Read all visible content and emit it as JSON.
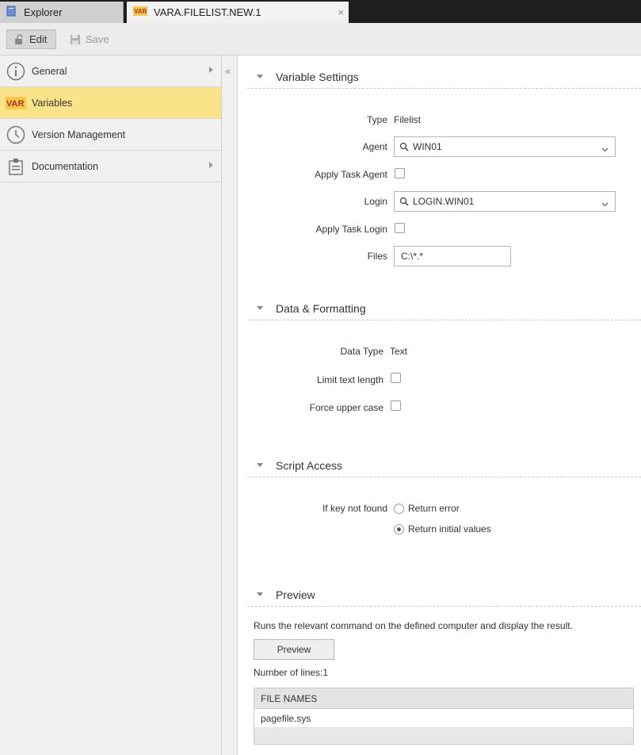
{
  "tabs": [
    {
      "label": "Explorer",
      "icon": "explorer-icon"
    },
    {
      "label": "VARA.FILELIST.NEW.1",
      "icon": "var-icon",
      "close": "×"
    }
  ],
  "toolbar": {
    "edit_label": "Edit",
    "save_label": "Save"
  },
  "sidebar": {
    "items": [
      {
        "label": "General",
        "icon": "info-icon"
      },
      {
        "label": "Variables",
        "icon": "var-icon",
        "icon_text": "VAR"
      },
      {
        "label": "Version Management",
        "icon": "clock-icon"
      },
      {
        "label": "Documentation",
        "icon": "clipboard-icon"
      }
    ],
    "selected_color": "#fbe38a"
  },
  "collapse": "«",
  "sections": {
    "variable_settings": {
      "title": "Variable Settings",
      "type_label": "Type",
      "type_value": "Filelist",
      "agent_label": "Agent",
      "agent_value": "WIN01",
      "apply_task_agent_label": "Apply Task Agent",
      "login_label": "Login",
      "login_value": "LOGIN.WIN01",
      "apply_task_login_label": "Apply Task Login",
      "files_label": "Files",
      "files_value": "C:\\*.*"
    },
    "data_formatting": {
      "title": "Data & Formatting",
      "data_type_label": "Data Type",
      "data_type_value": "Text",
      "limit_label": "Limit text length",
      "upper_label": "Force upper case"
    },
    "script_access": {
      "title": "Script Access",
      "key_label": "If key not found",
      "opt_error": "Return error",
      "opt_initial": "Return initial values"
    },
    "preview": {
      "title": "Preview",
      "description": "Runs the relevant command on the defined computer and display the result.",
      "button": "Preview",
      "lines": "Number of lines:1",
      "column": "FILE NAMES",
      "rows": [
        "pagefile.sys"
      ]
    }
  }
}
